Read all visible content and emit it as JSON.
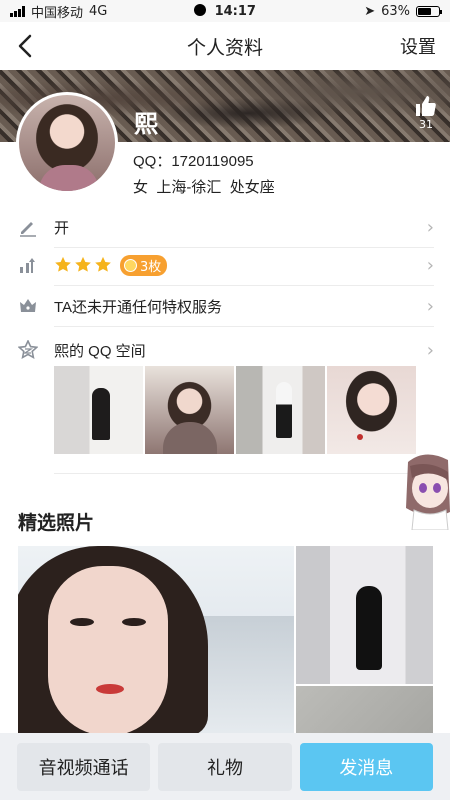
{
  "status_bar": {
    "carrier": "中国移动",
    "network": "4G",
    "time": "14:17",
    "battery": "63%",
    "battery_level": 0.63
  },
  "nav": {
    "title": "个人资料",
    "settings_label": "设置"
  },
  "profile": {
    "name": "熙",
    "qq_label": "QQ：1720119095",
    "gender": "女",
    "location": "上海-徐汇",
    "zodiac": "处女座",
    "likes": "31"
  },
  "rows": {
    "signature": "开",
    "level_badge": "3枚",
    "stars_count": 3,
    "vip": "TA还未开通任何特权服务",
    "qzone": "熙的 QQ 空间"
  },
  "photos_section": {
    "title": "精选照片"
  },
  "bottom": {
    "call_label": "音视频通话",
    "gift_label": "礼物",
    "message_label": "发消息"
  },
  "colors": {
    "accent": "#5bc6f2",
    "badge": "#f7a030",
    "star": "#f5b31c",
    "icon": "#8a9099"
  }
}
